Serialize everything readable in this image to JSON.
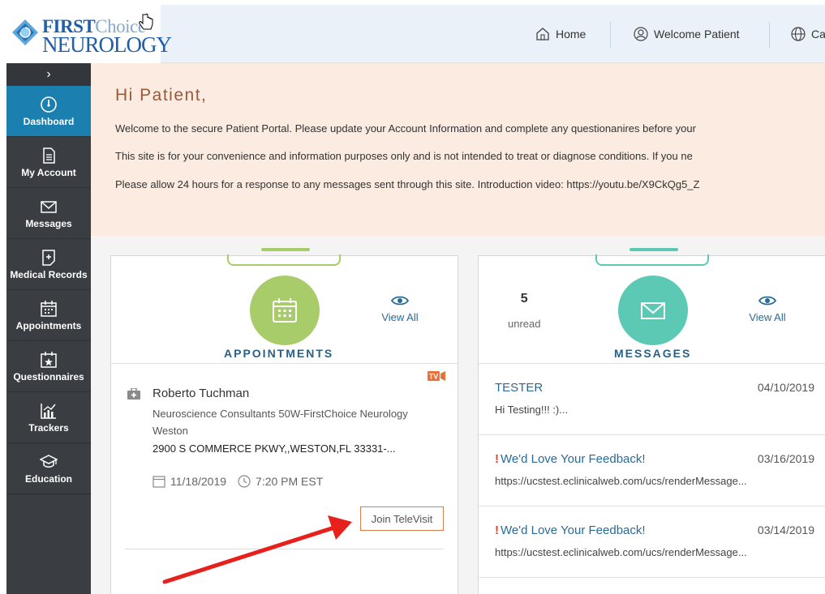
{
  "brand": {
    "logo_first": "FIRST",
    "logo_choice": "Choice",
    "logo_neuro": "NEUROLOGY"
  },
  "topnav": {
    "home": "Home",
    "welcome": "Welcome Patient",
    "lang_partial": "Ca"
  },
  "sidebar": {
    "toggle": "›",
    "items": [
      {
        "label": "Dashboard",
        "icon": "gauge-icon",
        "active": true
      },
      {
        "label": "My Account",
        "icon": "document-icon"
      },
      {
        "label": "Messages",
        "icon": "envelope-icon"
      },
      {
        "label": "Medical Records",
        "icon": "medical-record-icon"
      },
      {
        "label": "Appointments",
        "icon": "calendar-icon"
      },
      {
        "label": "Questionnaires",
        "icon": "calendar-star-icon"
      },
      {
        "label": "Trackers",
        "icon": "chart-icon"
      },
      {
        "label": "Education",
        "icon": "graduation-cap-icon"
      }
    ]
  },
  "banner": {
    "greeting": "Hi Patient,",
    "line1": "Welcome to the secure Patient Portal. Please update your Account Information and complete any questionanires before your",
    "line2": "This site is for your convenience and information purposes only and is not intended to treat or diagnose conditions. If you ne",
    "line3": "Please allow 24 hours for a response to any messages sent through this site. Introduction video: https://youtu.be/X9CkQg5_Z"
  },
  "appointments": {
    "title": "APPOINTMENTS",
    "view_all": "View All",
    "tv_badge": "TV",
    "doctor": "Roberto Tuchman",
    "practice": "Neuroscience Consultants 50W-FirstChoice Neurology Weston",
    "address": "2900 S COMMERCE PKWY,,WESTON,FL 33331-...",
    "date": "11/18/2019",
    "time": "7:20 PM EST",
    "join_label": "Join TeleVisit"
  },
  "messages": {
    "title": "MESSAGES",
    "view_all": "View All",
    "unread_count": "5",
    "unread_label": "unread",
    "items": [
      {
        "subject": "TESTER",
        "date": "04/10/2019",
        "preview": "Hi Testing!!! :)..."
      },
      {
        "subject": "We'd Love Your Feedback!",
        "date": "03/16/2019",
        "preview": "https://ucstest.eclinicalweb.com/ucs/renderMessage..."
      },
      {
        "subject": "We'd Love Your Feedback!",
        "date": "03/14/2019",
        "preview": "https://ucstest.eclinicalweb.com/ucs/renderMessage..."
      }
    ]
  },
  "colors": {
    "sidebar_bg": "#3a3d41",
    "sidebar_active": "#1b7fb0",
    "banner_bg": "#fbebe0",
    "appointments_accent": "#a8cc6a",
    "messages_accent": "#5cc9b5",
    "link_blue": "#2a6a96",
    "arrow_red": "#e8201c"
  }
}
